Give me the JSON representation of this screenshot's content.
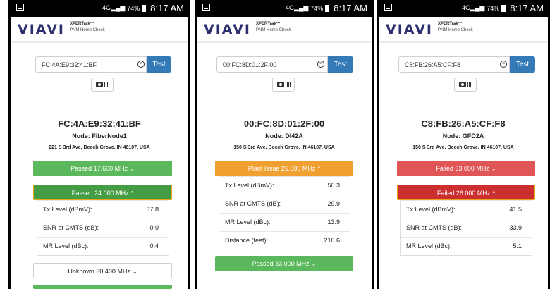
{
  "status": {
    "battery": "74%",
    "time": "8:17 AM"
  },
  "brand": {
    "logo": "VIAVI",
    "product": "XPERTrak™",
    "subtitle": "PNM Home Check"
  },
  "test_label": "Test",
  "screens": [
    {
      "mac_input": "FC:4A:E9:32:41:BF",
      "mac_title": "FC:4A:E9:32:41:BF",
      "node": "Node: FiberNode1",
      "address": "221 S 3rd Ave, Beech Grove, IN 46107, USA",
      "bands": [
        {
          "label": "Passed 17.600 MHz",
          "chevron": "⌄",
          "status": "passed"
        },
        {
          "label": "Passed 24.000 MHz",
          "chevron": "^",
          "status": "passed-open"
        },
        {
          "label": "Unknown 30.400 MHz",
          "chevron": "⌄",
          "status": "unknown"
        }
      ],
      "metrics": [
        {
          "label": "Tx Level (dBmV):",
          "value": "37.8"
        },
        {
          "label": "SNR at CMTS (dB):",
          "value": "0.0"
        },
        {
          "label": "MR Level (dBc):",
          "value": "0.4"
        }
      ]
    },
    {
      "mac_input": "00:FC:8D:01:2F:00",
      "mac_title": "00:FC:8D:01:2F:00",
      "node": "Node: DI42A",
      "address": "150 S 3rd Ave, Beech Grove, IN 46107, USA",
      "bands": [
        {
          "label": "Plant Issue 26.000 MHz",
          "chevron": "^",
          "status": "plant-issue-open"
        },
        {
          "label": "Passed 33.000 MHz",
          "chevron": "⌄",
          "status": "passed"
        }
      ],
      "metrics": [
        {
          "label": "Tx Level (dBmV):",
          "value": "50.3"
        },
        {
          "label": "SNR at CMTS (dB):",
          "value": "29.9"
        },
        {
          "label": "MR Level (dBc):",
          "value": "13.9"
        },
        {
          "label": "Distance (feet):",
          "value": "210.6"
        }
      ]
    },
    {
      "mac_input": "C8:FB:26:A5:CF:F8",
      "mac_title": "C8:FB:26:A5:CF:F8",
      "node": "Node: GFD2A",
      "address": "150 S 3rd Ave, Beech Grove, IN 46107, USA",
      "bands": [
        {
          "label": "Failed 33.000 MHz",
          "chevron": "⌄",
          "status": "failed"
        },
        {
          "label": "Failed 26.000 MHz",
          "chevron": "^",
          "status": "failed-open"
        }
      ],
      "metrics": [
        {
          "label": "Tx Level (dBmV):",
          "value": "41.5"
        },
        {
          "label": "SNR at CMTS (dB):",
          "value": "33.9"
        },
        {
          "label": "MR Level (dBc):",
          "value": "5.1"
        }
      ]
    }
  ],
  "colors": {
    "passed": "#5cb85c",
    "passed_open": "#449d44",
    "plant_issue": "#f0a030",
    "failed": "#e05555",
    "failed_open": "#cc2f2f",
    "test_button": "#337ab7",
    "brand": "#2c2f6e"
  }
}
